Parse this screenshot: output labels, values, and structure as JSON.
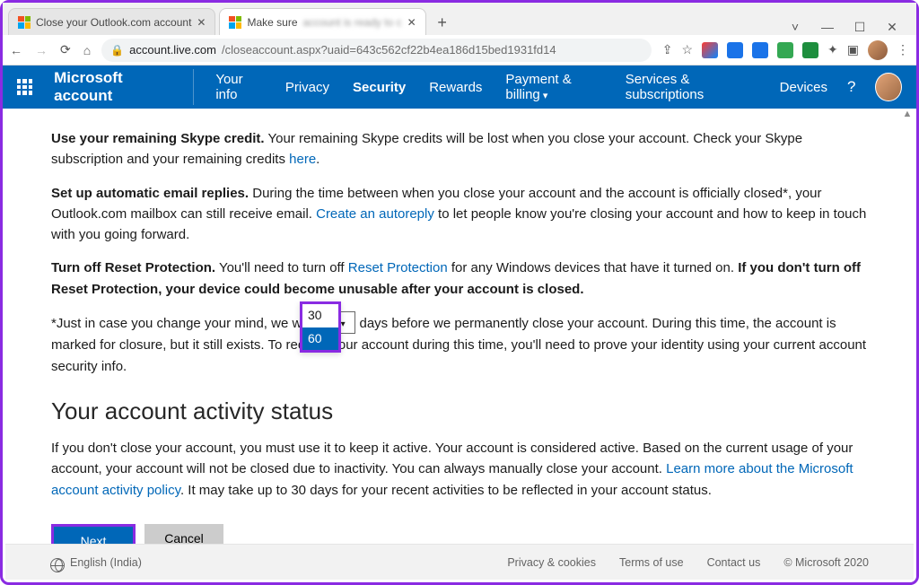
{
  "browser": {
    "tabs": [
      {
        "title": "Close your Outlook.com account"
      },
      {
        "title": "Make sure"
      }
    ],
    "url_host": "account.live.com",
    "url_path": "/closeaccount.aspx?uaid=643c562cf22b4ea186d15bed1931fd14",
    "win": {
      "min": "—",
      "max": "☐",
      "close": "✕",
      "down": "˅"
    }
  },
  "nav": {
    "brand": "Microsoft account",
    "links": {
      "yourinfo": "Your info",
      "privacy": "Privacy",
      "security": "Security",
      "rewards": "Rewards",
      "payment": "Payment & billing",
      "services": "Services & subscriptions",
      "devices": "Devices"
    },
    "help": "?"
  },
  "content": {
    "skype_bold": "Use your remaining Skype credit.",
    "skype_text": " Your remaining Skype credits will be lost when you close your account. Check your Skype subscription and your remaining credits ",
    "here": "here",
    "period": ".",
    "autoreply_bold": "Set up automatic email replies.",
    "autoreply_text1": " During the time between when you close your account and the account is officially closed*, your Outlook.com mailbox can still receive email. ",
    "autoreply_link": "Create an autoreply",
    "autoreply_text2": " to let people know you're closing your account and how to keep in touch with you going forward.",
    "reset_bold": "Turn off Reset Protection.",
    "reset_text1": " You'll need to turn off ",
    "reset_link": "Reset Protection",
    "reset_text2": " for any Windows devices that have it turned on. ",
    "reset_bold2": "If you don't turn off Reset Protection, your device could become unusable after your account is closed.",
    "wait_text1": "*Just in case you change your mind, we wait ",
    "wait_select": "60",
    "wait_options": [
      "30",
      "60"
    ],
    "wait_text2": " days before we permanently close your account. During this time, the account is marked for closure, but it still exists. To reopen your account during this time, you'll need to prove your identity using your current account security info.",
    "status_heading": "Your account activity status",
    "status_text1": "If you don't close your account, you must use it to keep it active. Your account is considered active. Based on the current usage of your account, your account will not be closed due to inactivity. You can always manually close your account. ",
    "status_link": "Learn more about the Microsoft account activity policy",
    "status_text2": ". It may take up to 30 days for your recent activities to be reflected in your account status.",
    "btn_next": "Next",
    "btn_cancel": "Cancel"
  },
  "footer": {
    "lang": "English (India)",
    "privacy": "Privacy & cookies",
    "terms": "Terms of use",
    "contact": "Contact us",
    "copyright": "© Microsoft 2020"
  }
}
